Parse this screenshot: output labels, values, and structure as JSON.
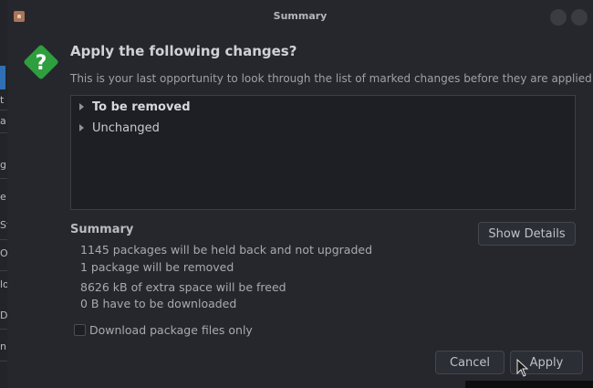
{
  "window": {
    "title": "Summary"
  },
  "header": {
    "heading": "Apply the following changes?",
    "description": "This is your last opportunity to look through the list of marked changes before they are applied."
  },
  "tree": {
    "items": [
      {
        "label": "To be removed"
      },
      {
        "label": "Unchanged"
      }
    ]
  },
  "summary": {
    "title": "Summary",
    "held_back": "1145 packages will be held back and not upgraded",
    "removed": "1 package will be removed",
    "freed": "8626 kB of extra space will be freed",
    "download": "0  B have to be downloaded"
  },
  "buttons": {
    "show_details": "Show Details",
    "cancel": "Cancel",
    "apply": "Apply"
  },
  "options": {
    "download_only_label": "Download package files only"
  },
  "background_fragments": [
    "t",
    "a",
    "g",
    "e",
    "St",
    "O",
    "lo",
    "D",
    "n"
  ],
  "colors": {
    "question_icon": "#2e9e3e",
    "window_bg": "#25272d"
  }
}
